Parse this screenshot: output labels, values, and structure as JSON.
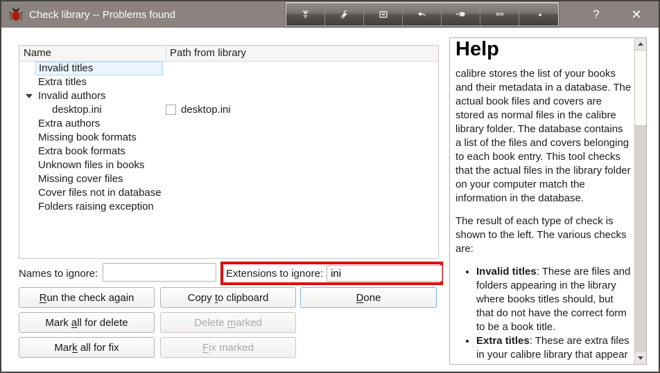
{
  "window": {
    "title": "Check library -- Problems found",
    "help_glyph": "?",
    "close_glyph": "✕"
  },
  "titlebar_tools": [
    "shade-icon",
    "wrench-icon",
    "maximize-icon",
    "undo-icon",
    "pin-icon",
    "minimize-icon",
    "resize-dot-icon"
  ],
  "colors": {
    "titlebar": "#8a8380",
    "selection_bg": "#eaf5fd",
    "selection_border": "#aed7f5",
    "annotation_red": "#dc1010",
    "default_button_border": "#7db3df"
  },
  "tree": {
    "columns": [
      "Name",
      "Path from library"
    ],
    "rows": [
      {
        "name": "Invalid titles"
      },
      {
        "name": "Extra titles"
      },
      {
        "name": "Invalid authors"
      },
      {
        "name": "desktop.ini",
        "path": "desktop.ini"
      },
      {
        "name": "Extra authors"
      },
      {
        "name": "Missing book formats"
      },
      {
        "name": "Extra book formats"
      },
      {
        "name": "Unknown files in books"
      },
      {
        "name": "Missing cover files"
      },
      {
        "name": "Cover files not in database"
      },
      {
        "name": "Folders raising exception"
      }
    ]
  },
  "ignore": {
    "names_label": "Names to ignore:",
    "names_value": "",
    "extensions_label": "Extensions to ignore:",
    "extensions_value": "ini"
  },
  "buttons": {
    "run_check": {
      "pre": "",
      "key": "R",
      "post": "un the check again"
    },
    "copy_clipboard": {
      "pre": "Copy ",
      "key": "t",
      "post": "o clipboard"
    },
    "done": {
      "pre": "",
      "key": "D",
      "post": "one"
    },
    "mark_delete": {
      "pre": "Mark ",
      "key": "a",
      "post": "ll for delete"
    },
    "delete_marked": {
      "pre": "Delete ",
      "key": "m",
      "post": "arked"
    },
    "mark_fix": {
      "pre": "Mar",
      "key": "k",
      "post": " all for fix"
    },
    "fix_marked": {
      "pre": "",
      "key": "F",
      "post": "ix marked"
    }
  },
  "help": {
    "heading": "Help",
    "para1": "calibre stores the list of your books and their metadata in a database. The actual book files and covers are stored as normal files in the calibre library folder. The database contains a list of the files and covers belonging to each book entry. This tool checks that the actual files in the library folder on your computer match the information in the database.",
    "para2": "The result of each type of check is shown to the left. The various checks are:",
    "bullets": [
      {
        "term": "Invalid titles",
        "text": ": These are files and folders appearing in the library where books titles should, but that do not have the correct form to be a book title."
      },
      {
        "term": "Extra titles",
        "text": ": These are extra files in your calibre library that appear"
      }
    ]
  }
}
